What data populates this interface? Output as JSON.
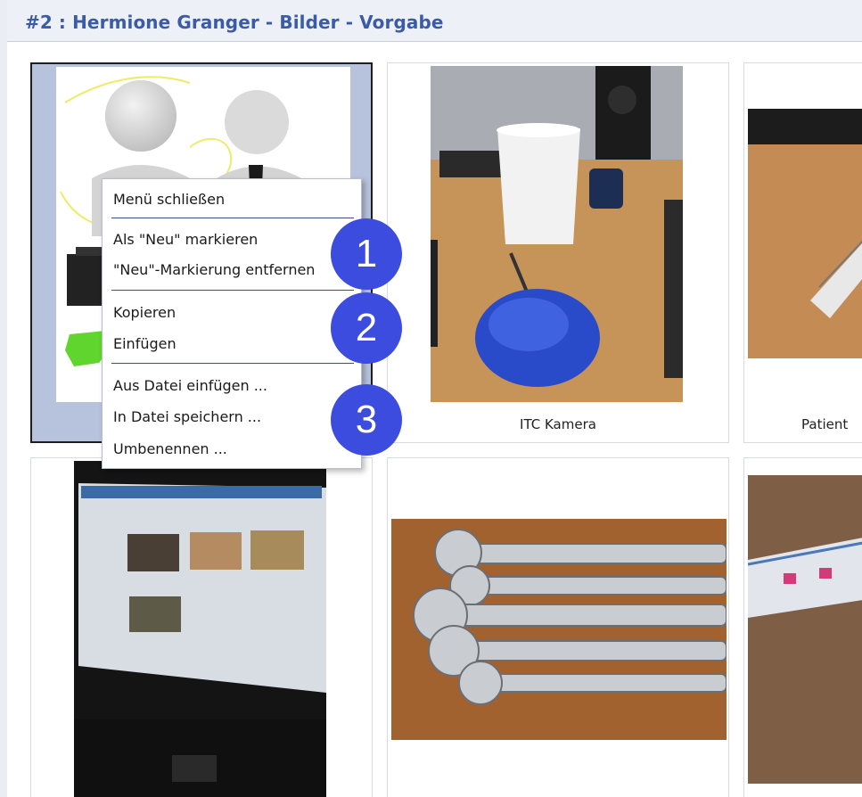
{
  "header": {
    "title": "#2 : Hermione Granger - Bilder - Vorgabe"
  },
  "tiles": {
    "camera_caption": "ITC Kamera",
    "partial_caption": "Patient"
  },
  "context_menu": {
    "items": [
      "Menü schließen",
      "Als \"Neu\" markieren",
      "\"Neu\"-Markierung entfernen",
      "Kopieren",
      "Einfügen",
      "Aus Datei einfügen ...",
      "In Datei speichern ...",
      "Umbenennen ..."
    ]
  },
  "badges": [
    "1",
    "2",
    "3"
  ],
  "colors": {
    "title": "#3a5ca8",
    "badge": "#3c4cdf",
    "selection": "#b7c3dd"
  }
}
